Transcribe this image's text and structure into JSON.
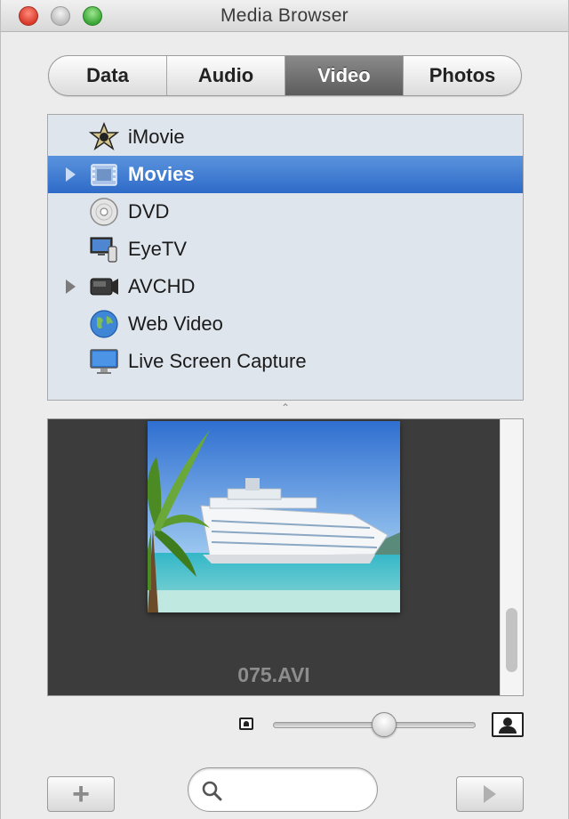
{
  "window": {
    "title": "Media Browser"
  },
  "tabs": [
    {
      "label": "Data",
      "active": false
    },
    {
      "label": "Audio",
      "active": false
    },
    {
      "label": "Video",
      "active": true
    },
    {
      "label": "Photos",
      "active": false
    }
  ],
  "sources": [
    {
      "label": "iMovie",
      "icon": "imovie-star-icon",
      "expandable": false,
      "selected": false
    },
    {
      "label": "Movies",
      "icon": "movies-folder-icon",
      "expandable": true,
      "selected": true
    },
    {
      "label": "DVD",
      "icon": "dvd-disc-icon",
      "expandable": false,
      "selected": false
    },
    {
      "label": "EyeTV",
      "icon": "eyetv-icon",
      "expandable": false,
      "selected": false
    },
    {
      "label": "AVCHD",
      "icon": "camcorder-icon",
      "expandable": true,
      "selected": false
    },
    {
      "label": "Web Video",
      "icon": "globe-icon",
      "expandable": false,
      "selected": false
    },
    {
      "label": "Live Screen Capture",
      "icon": "display-icon",
      "expandable": false,
      "selected": false
    }
  ],
  "preview": {
    "clip_name": "075.AVI",
    "thumbnail": "cruise-ship-thumbnail"
  },
  "thumbnail_size": {
    "level": 0.55
  },
  "search": {
    "value": "",
    "placeholder": ""
  },
  "colors": {
    "selection": "#2e6bc8",
    "source_bg": "#dfe5ec",
    "preview_bg": "#3c3c3c"
  }
}
